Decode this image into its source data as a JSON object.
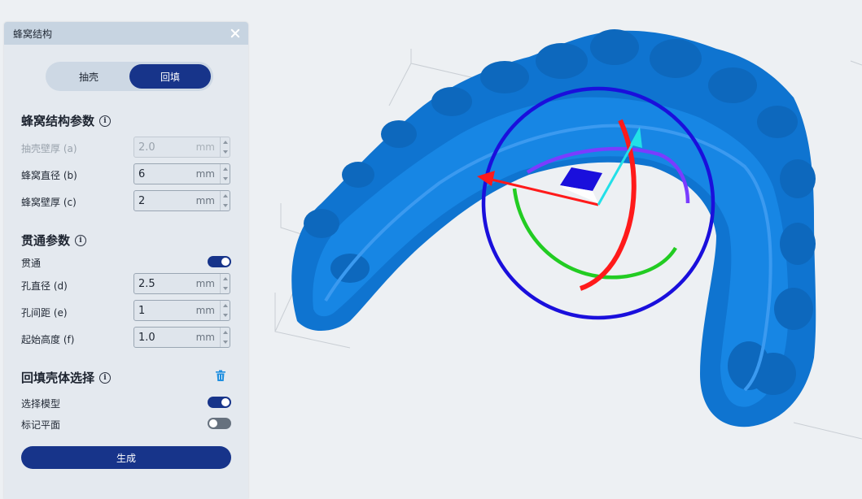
{
  "panel": {
    "title": "蜂窝结构",
    "close_icon": "close-icon",
    "segments": [
      {
        "label": "抽壳",
        "active": false
      },
      {
        "label": "回填",
        "active": true
      }
    ]
  },
  "honeycomb_params": {
    "title": "蜂窝结构参数",
    "rows": [
      {
        "label": "抽壳壁厚 (a)",
        "value": "2.0",
        "unit": "mm",
        "disabled": true
      },
      {
        "label": "蜂窝直径 (b)",
        "value": "6",
        "unit": "mm",
        "disabled": false
      },
      {
        "label": "蜂窝壁厚 (c)",
        "value": "2",
        "unit": "mm",
        "disabled": false
      }
    ]
  },
  "through_params": {
    "title": "贯通参数",
    "toggle_label": "贯通",
    "toggle_on": true,
    "rows": [
      {
        "label": "孔直径 (d)",
        "value": "2.5",
        "unit": "mm"
      },
      {
        "label": "孔间距 (e)",
        "value": "1",
        "unit": "mm"
      },
      {
        "label": "起始高度 (f)",
        "value": "1.0",
        "unit": "mm"
      }
    ]
  },
  "fill_shell": {
    "title": "回填壳体选择",
    "trash_icon": "trash-icon",
    "select_model_label": "选择模型",
    "select_model_on": true,
    "mark_plane_label": "标记平面",
    "mark_plane_on": false
  },
  "generate_label": "生成",
  "colors": {
    "accent": "#17348a",
    "model": "#0f74d0",
    "gizmo_x": "#ff1a1a",
    "gizmo_y": "#22cc22",
    "gizmo_z": "#1a0fdc",
    "gizmo_axis_z": "#22e0e8"
  }
}
